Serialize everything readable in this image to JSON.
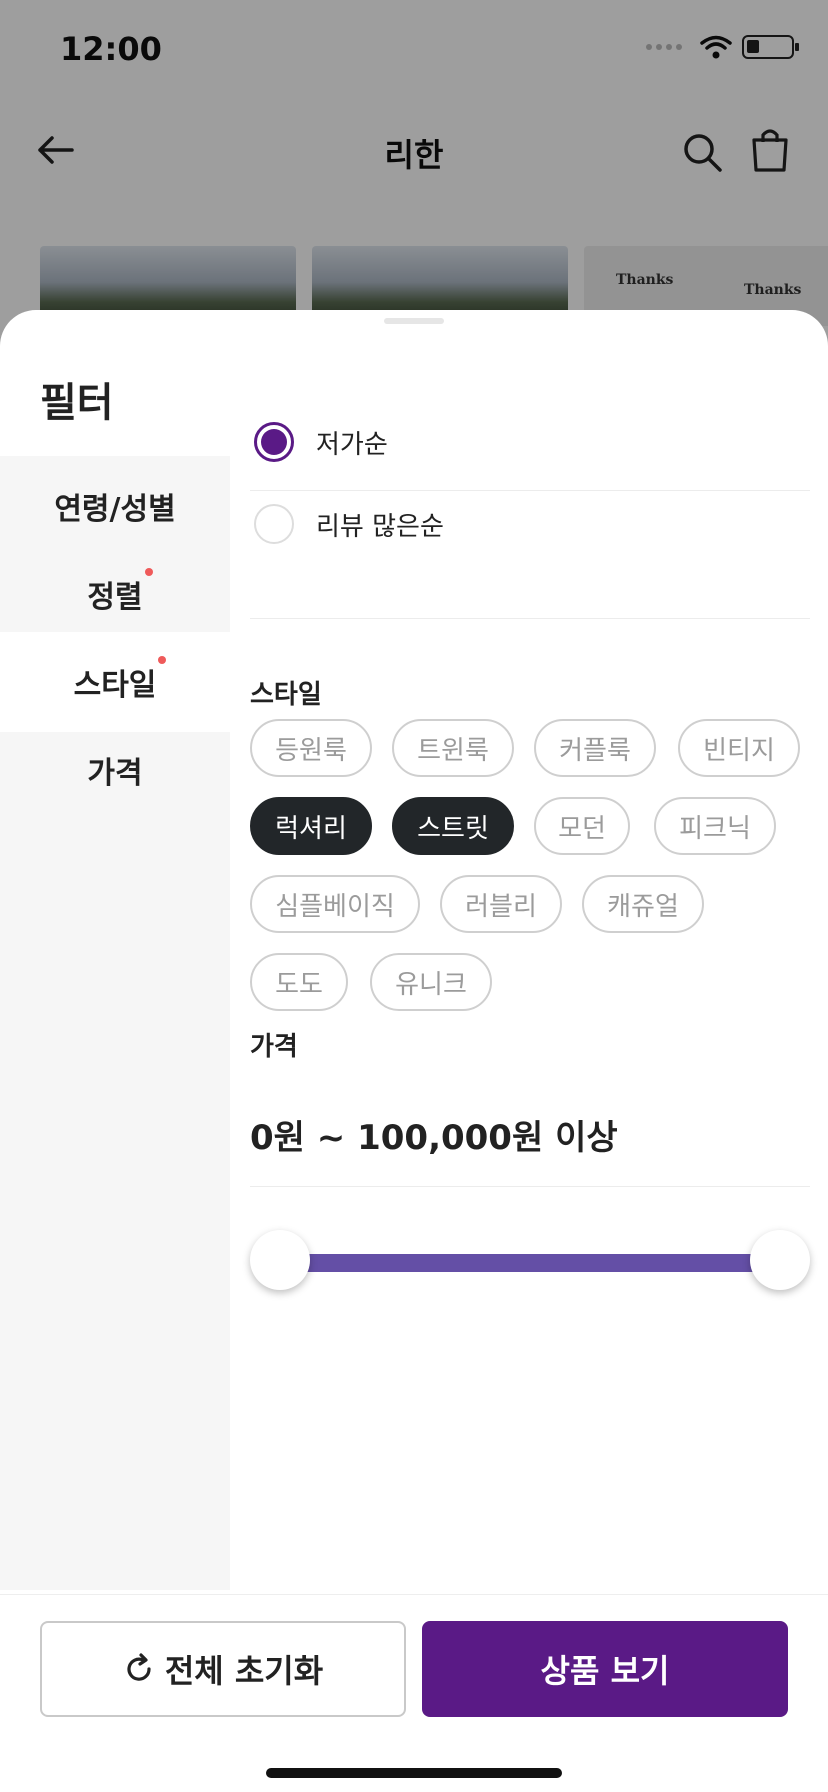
{
  "status_bar": {
    "time": "12:00"
  },
  "header": {
    "title": "리한"
  },
  "background": {
    "thumb_text_1": "Thanks",
    "thumb_text_2": "Thanks"
  },
  "sheet": {
    "title": "필터",
    "nav": [
      {
        "label": "연령/성별",
        "dot": false
      },
      {
        "label": "정렬",
        "dot": true
      },
      {
        "label": "스타일",
        "dot": true,
        "active": true
      },
      {
        "label": "가격",
        "dot": false
      }
    ],
    "sort": {
      "options": [
        {
          "label": "저가순",
          "selected": true
        },
        {
          "label": "리뷰 많은순",
          "selected": false
        }
      ]
    },
    "style": {
      "title": "스타일",
      "chips": [
        {
          "label": "등원룩",
          "selected": false
        },
        {
          "label": "트윈룩",
          "selected": false
        },
        {
          "label": "커플룩",
          "selected": false
        },
        {
          "label": "빈티지",
          "selected": false
        },
        {
          "label": "럭셔리",
          "selected": true
        },
        {
          "label": "스트릿",
          "selected": true
        },
        {
          "label": "모던",
          "selected": false
        },
        {
          "label": "피크닉",
          "selected": false
        },
        {
          "label": "심플베이직",
          "selected": false
        },
        {
          "label": "러블리",
          "selected": false
        },
        {
          "label": "캐쥬얼",
          "selected": false
        },
        {
          "label": "도도",
          "selected": false
        },
        {
          "label": "유니크",
          "selected": false
        }
      ]
    },
    "price": {
      "title": "가격",
      "range_text": "0원 ~ 100,000원 이상",
      "min_fraction": 0,
      "max_fraction": 1
    }
  },
  "footer": {
    "reset_label": "전체 초기화",
    "view_label": "상품 보기"
  },
  "colors": {
    "accent": "#5a1a86",
    "slider": "#644fa6",
    "selected_chip": "#222629",
    "dot": "#ef5a5a"
  }
}
